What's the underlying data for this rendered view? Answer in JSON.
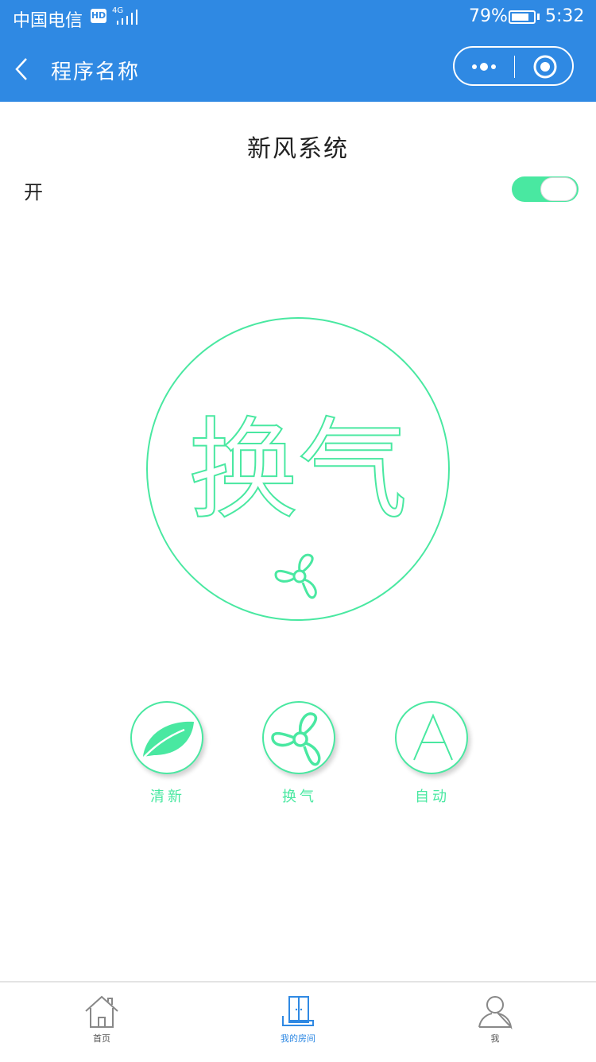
{
  "status_bar": {
    "carrier": "中国电信",
    "hd_badge": "HD",
    "network": "4G",
    "battery_percent": "79%",
    "battery_level": 0.79,
    "time": "5:32"
  },
  "nav": {
    "title": "程序名称",
    "back_icon": "chevron-left-icon",
    "more_icon": "more-dots-icon",
    "close_icon": "record-circle-icon"
  },
  "page": {
    "title": "新风系统",
    "power_label": "开",
    "power_on": true
  },
  "current_mode": {
    "text": "换气",
    "icon": "fan-icon"
  },
  "modes": [
    {
      "label": "清新",
      "icon": "leaf-icon"
    },
    {
      "label": "换气",
      "icon": "fan-icon"
    },
    {
      "label": "自动",
      "icon": "letter-a-icon"
    }
  ],
  "tabbar": [
    {
      "label": "首页",
      "icon": "home-icon",
      "active": false
    },
    {
      "label": "我的房间",
      "icon": "door-icon",
      "active": true
    },
    {
      "label": "我",
      "icon": "user-icon",
      "active": false
    }
  ],
  "colors": {
    "primary_blue": "#2f89e3",
    "accent_green": "#49e8a1"
  }
}
